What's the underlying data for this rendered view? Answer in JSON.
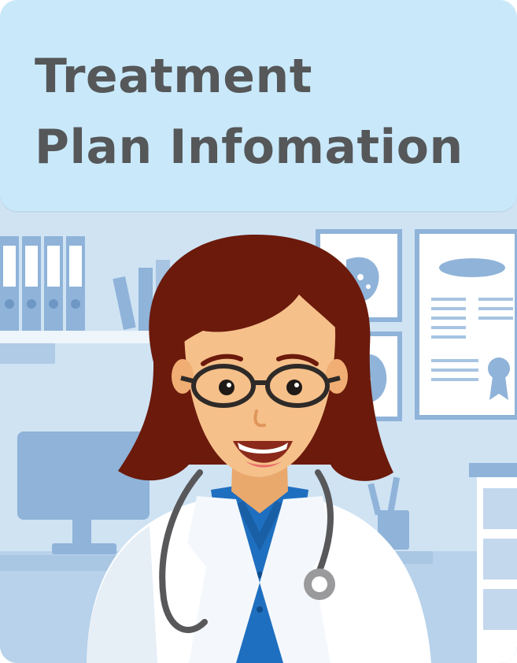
{
  "card": {
    "title_line1": "Treatment",
    "title_line2": "Plan Infomation"
  },
  "colors": {
    "header_bg": "#c9e9fa",
    "title_text": "#555759",
    "scene_bg": "#cfe3f3",
    "hair": "#6b1a0c",
    "skin": "#f6c08a",
    "coat": "#ffffff",
    "shirt": "#1f6fc0"
  },
  "illustration": {
    "subject": "doctor-with-stethoscope",
    "icons": [
      "binders-icon",
      "books-icon",
      "monitor-icon",
      "anatomy-poster-icon",
      "kidney-poster-icon",
      "certificate-icon",
      "pen-cup-icon",
      "cabinet-icon"
    ]
  }
}
